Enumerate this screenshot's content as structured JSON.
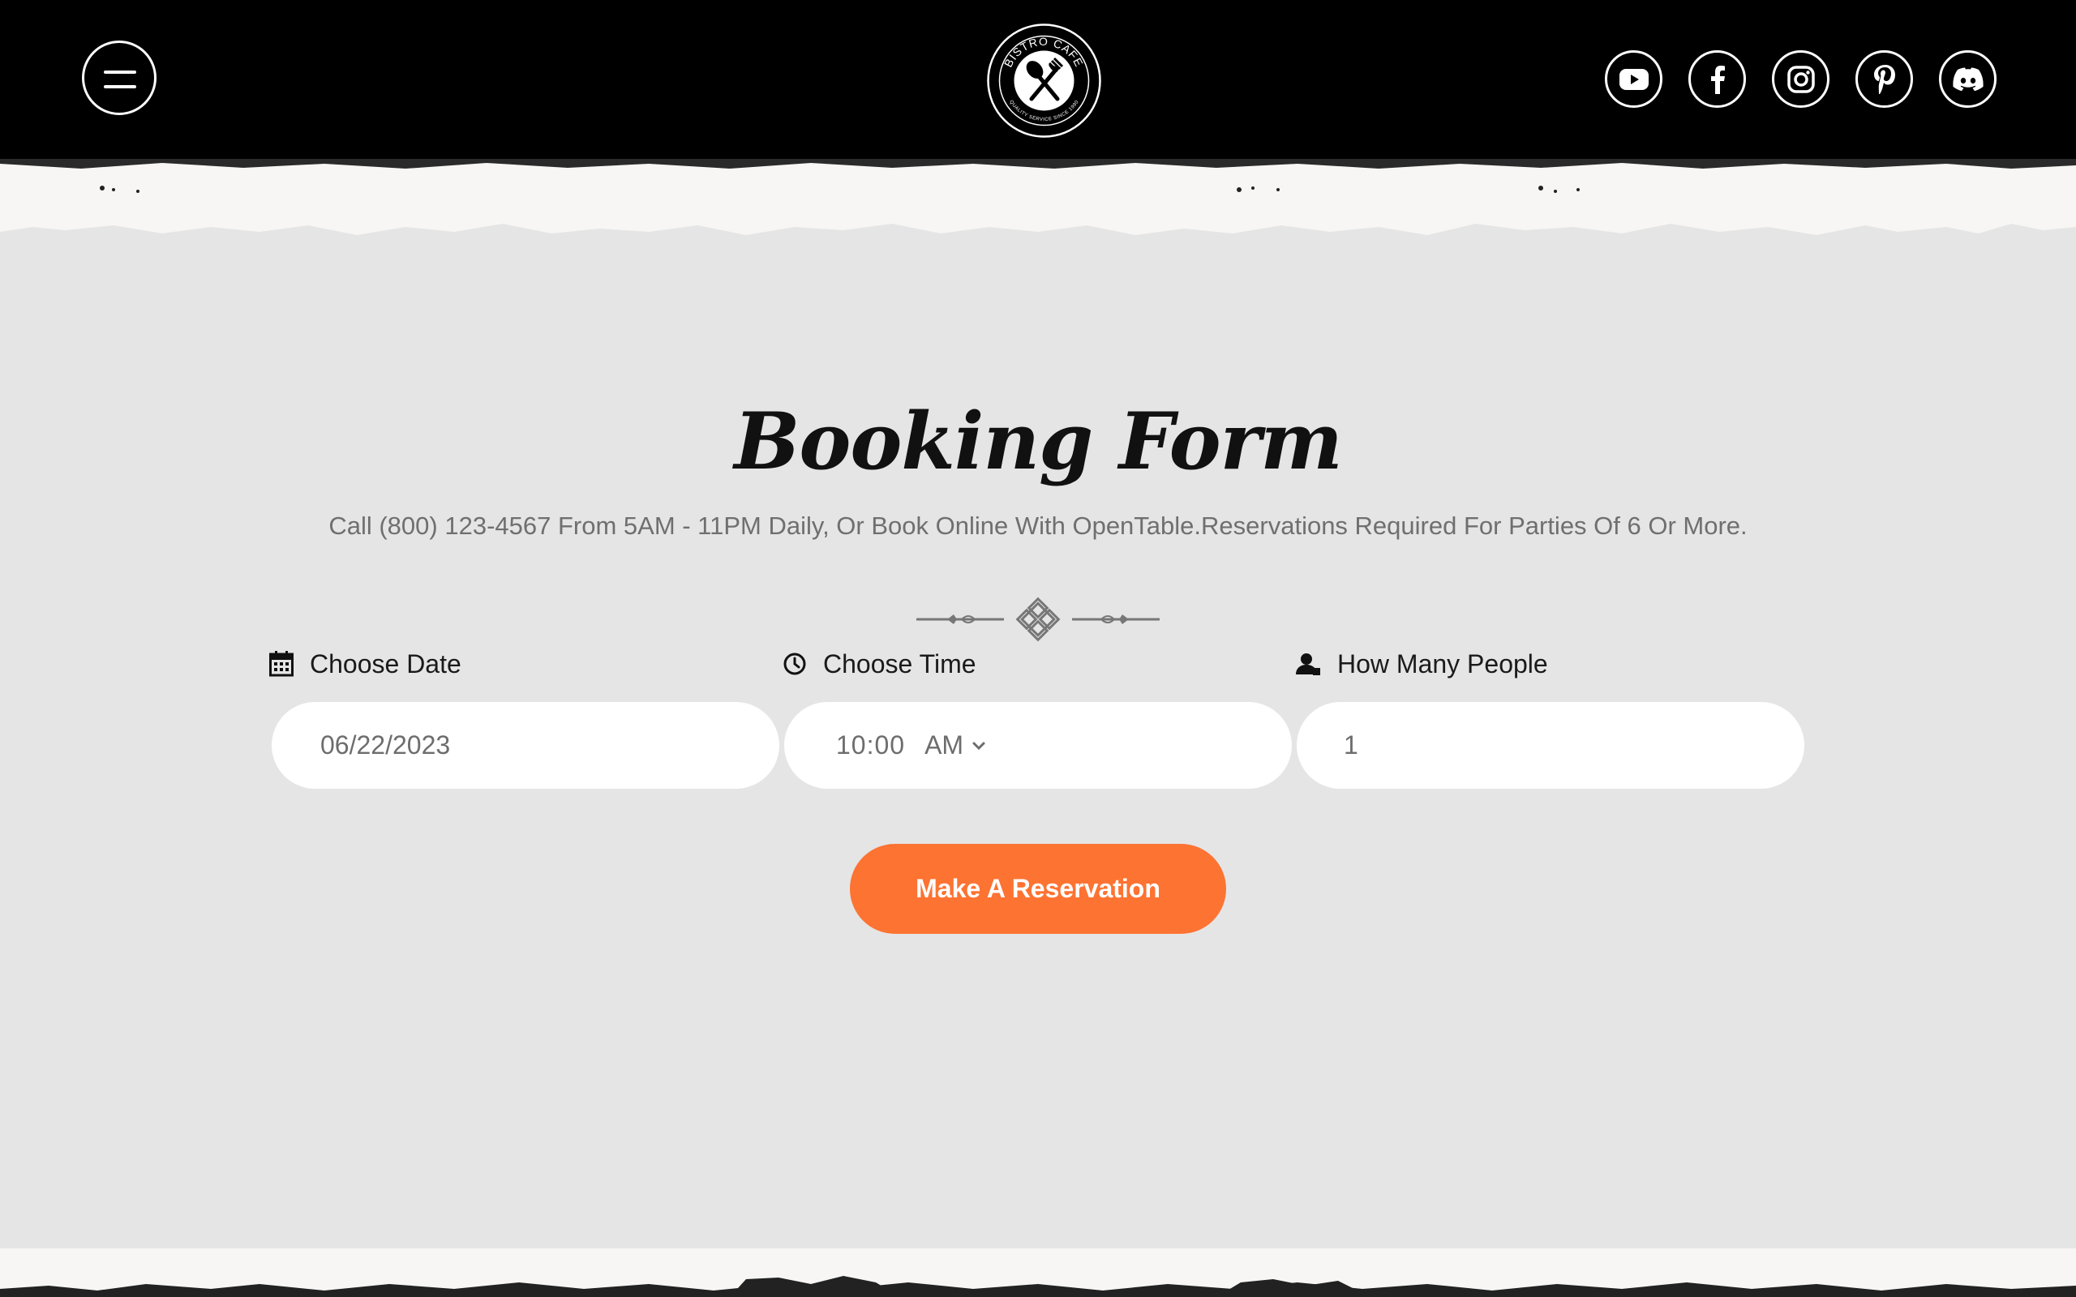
{
  "header": {
    "menu_icon": "hamburger-menu-icon",
    "logo": {
      "name": "BISTRO CAFE",
      "tagline": "QUALITY SERVICE SINCE 1990",
      "icon": "spoon-fork-icon"
    },
    "socials": [
      {
        "name": "YouTube",
        "icon": "youtube-icon"
      },
      {
        "name": "Facebook",
        "icon": "facebook-icon"
      },
      {
        "name": "Instagram",
        "icon": "instagram-icon"
      },
      {
        "name": "Pinterest",
        "icon": "pinterest-icon"
      },
      {
        "name": "Discord",
        "icon": "discord-icon"
      }
    ]
  },
  "booking": {
    "title": "Booking Form",
    "subtitle": "Call (800) 123-4567 From 5AM - 11PM Daily, Or Book Online With OpenTable.Reservations Required For Parties Of 6 Or More.",
    "date": {
      "label": "Choose Date",
      "icon": "calendar-icon",
      "value": "06/22/2023"
    },
    "time": {
      "label": "Choose Time",
      "icon": "clock-icon",
      "value": "10:00",
      "period": "AM"
    },
    "people": {
      "label": "How Many People",
      "icon": "person-icon",
      "value": "1"
    },
    "submit_label": "Make A Reservation"
  },
  "colors": {
    "header_bg": "#000000",
    "page_bg": "#e5e5e5",
    "accent": "#fd7332",
    "input_bg": "#ffffff",
    "muted_text": "#6f6f6f"
  }
}
